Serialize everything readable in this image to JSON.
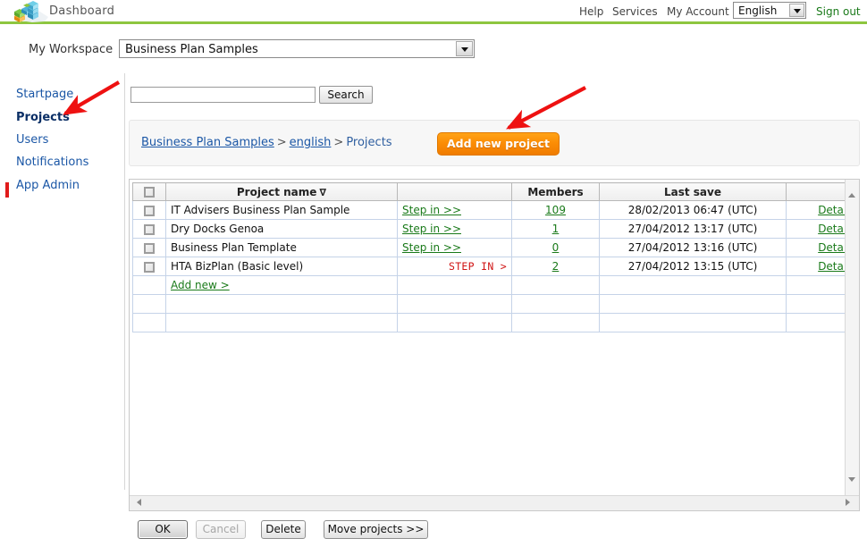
{
  "header": {
    "app_title": "Dashboard",
    "logo_icon": "isometric-blocks-logo",
    "links": [
      {
        "id": "help",
        "label": "Help"
      },
      {
        "id": "services",
        "label": "Services"
      },
      {
        "id": "account",
        "label": "My Account"
      }
    ],
    "language": {
      "selected": "English",
      "dropdown_icon": "chevron-down-icon"
    },
    "sign_out_label": "Sign out",
    "accent_green": "#8dc63f",
    "sign_out_color": "#1a7a1a"
  },
  "workspace": {
    "label": "My Workspace",
    "selected": "Business Plan Samples",
    "dropdown_icon": "chevron-down-icon"
  },
  "sidebar": {
    "items": [
      {
        "id": "startpage",
        "label": "Startpage",
        "active": false
      },
      {
        "id": "projects",
        "label": "Projects",
        "active": true
      },
      {
        "id": "users",
        "label": "Users",
        "active": false
      },
      {
        "id": "notifications",
        "label": "Notifications",
        "active": false
      },
      {
        "id": "app-admin",
        "label": "App Admin",
        "active": false
      }
    ],
    "active_marker_color": "#e01b1b"
  },
  "search": {
    "value": "",
    "placeholder": "",
    "button_label": "Search"
  },
  "breadcrumb": {
    "items": [
      {
        "label": "Business Plan Samples",
        "link": true
      },
      {
        "label": "english",
        "link": true
      },
      {
        "label": "Projects",
        "link": false
      }
    ],
    "separator": ">"
  },
  "actions": {
    "add_new_project_label": "Add new project",
    "add_new_project_color": "#fb8c05"
  },
  "table": {
    "columns": [
      {
        "id": "check",
        "label": ""
      },
      {
        "id": "name",
        "label": "Project name",
        "sort_icon": "sort-descending-icon",
        "sort_glyph": "∇"
      },
      {
        "id": "step",
        "label": ""
      },
      {
        "id": "members",
        "label": "Members"
      },
      {
        "id": "save",
        "label": "Last save"
      },
      {
        "id": "details",
        "label": ""
      }
    ],
    "rows": [
      {
        "name": "IT Advisers Business Plan Sample",
        "step_label": "Step in >>",
        "step_style": "green-link",
        "members": "109",
        "last_save": "28/02/2013 06:47 (UTC)",
        "details_label": "Details"
      },
      {
        "name": "Dry Docks Genoa",
        "step_label": "Step in >>",
        "step_style": "green-link",
        "members": "1",
        "last_save": "27/04/2012 13:17 (UTC)",
        "details_label": "Details"
      },
      {
        "name": "Business Plan Template",
        "step_label": "Step in >>",
        "step_style": "green-link",
        "members": "0",
        "last_save": "27/04/2012 13:16 (UTC)",
        "details_label": "Details"
      },
      {
        "name": "HTA BizPlan (Basic level)",
        "step_label": "STEP IN >",
        "step_style": "red-text",
        "members": "2",
        "last_save": "27/04/2012 13:15 (UTC)",
        "details_label": "Details"
      }
    ],
    "add_new_row_label": "Add new >",
    "empty_row_count": 2,
    "link_green": "#1a7a1a",
    "stepin_red": "#d01414"
  },
  "scrollbars": {
    "vertical_up_icon": "triangle-up-icon",
    "vertical_down_icon": "triangle-down-icon",
    "horizontal_left_icon": "triangle-left-icon",
    "horizontal_right_icon": "triangle-right-icon"
  },
  "footer_buttons": [
    {
      "id": "ok",
      "label": "OK",
      "state": "focused"
    },
    {
      "id": "cancel",
      "label": "Cancel",
      "state": "disabled"
    },
    {
      "id": "delete",
      "label": "Delete",
      "state": "normal"
    },
    {
      "id": "move",
      "label": "Move projects >>",
      "state": "normal"
    }
  ],
  "annotations": {
    "arrow_color": "#ee1111",
    "arrows": [
      {
        "id": "arrow-to-projects",
        "target": "sidebar-item-projects"
      },
      {
        "id": "arrow-to-add-project",
        "target": "add-new-project-button"
      }
    ]
  }
}
